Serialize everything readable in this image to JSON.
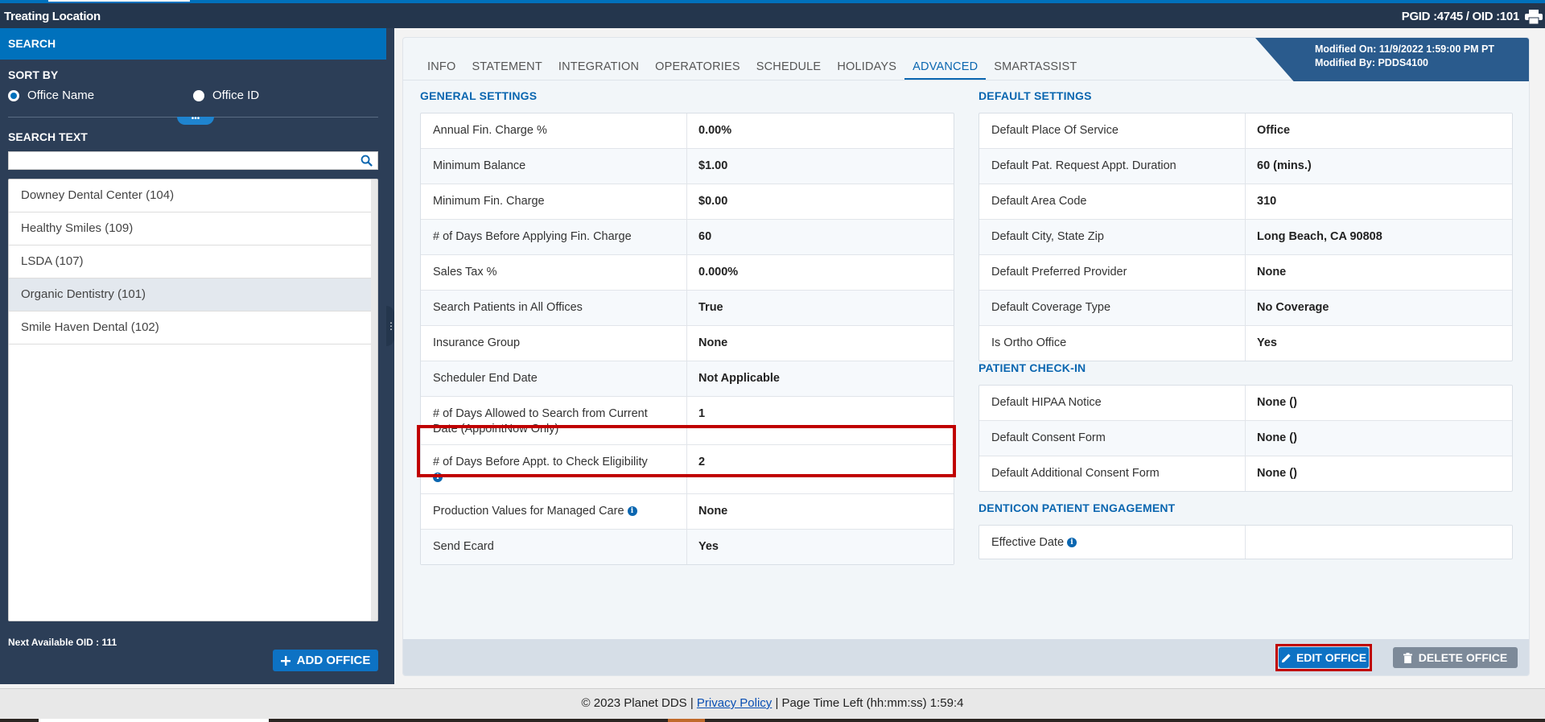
{
  "titlebar": {
    "title": "Treating Location",
    "ids": "PGID :4745  /  OID :101"
  },
  "sidebar": {
    "header": "SEARCH",
    "sort_label": "SORT BY",
    "sort_options": [
      "Office Name",
      "Office ID"
    ],
    "sort_selected": "Office Name",
    "search_label": "SEARCH TEXT",
    "search_value": "",
    "offices": [
      "Downey Dental Center (104)",
      "Healthy Smiles (109)",
      "LSDA (107)",
      "Organic Dentistry (101)",
      "Smile Haven Dental (102)"
    ],
    "active_office": "Organic Dentistry (101)",
    "next_oid": "Next Available OID : 111",
    "add_button": "ADD OFFICE",
    "grip_glyph": "•••"
  },
  "main": {
    "tabs": [
      "INFO",
      "STATEMENT",
      "INTEGRATION",
      "OPERATORIES",
      "SCHEDULE",
      "HOLIDAYS",
      "ADVANCED",
      "SMARTASSIST"
    ],
    "active_tab": "ADVANCED",
    "modified_on": "Modified On: 11/9/2022 1:59:00 PM PT",
    "modified_by": "Modified By: PDDS4100",
    "general": {
      "title": "GENERAL SETTINGS",
      "rows": [
        {
          "label": "Annual Fin. Charge %",
          "value": "0.00%"
        },
        {
          "label": "Minimum Balance",
          "value": "$1.00"
        },
        {
          "label": "Minimum Fin. Charge",
          "value": "$0.00"
        },
        {
          "label": "# of Days Before Applying Fin. Charge",
          "value": "60"
        },
        {
          "label": "Sales Tax %",
          "value": "0.000%"
        },
        {
          "label": "Search Patients in All Offices",
          "value": "True"
        },
        {
          "label": "Insurance Group",
          "value": "None"
        },
        {
          "label": "Scheduler End Date",
          "value": "Not Applicable"
        },
        {
          "label": "# of Days Allowed to Search from Current Date (AppointNow Only)",
          "value": "1"
        },
        {
          "label": "# of Days Before Appt. to Check Eligibility",
          "value": "2"
        },
        {
          "label": "Production Values for Managed Care",
          "value": "None"
        },
        {
          "label": "Send Ecard",
          "value": "Yes"
        }
      ]
    },
    "default": {
      "title": "DEFAULT SETTINGS",
      "rows": [
        {
          "label": "Default Place Of Service",
          "value": "Office"
        },
        {
          "label": "Default Pat. Request Appt. Duration",
          "value": "60 (mins.)"
        },
        {
          "label": "Default Area Code",
          "value": "310"
        },
        {
          "label": "Default City, State Zip",
          "value": "Long Beach, CA 90808"
        },
        {
          "label": "Default Preferred Provider",
          "value": "None"
        },
        {
          "label": "Default Coverage Type",
          "value": "No Coverage"
        },
        {
          "label": "Is Ortho Office",
          "value": "Yes"
        }
      ]
    },
    "checkin": {
      "title": "PATIENT CHECK-IN",
      "rows": [
        {
          "label": "Default HIPAA Notice",
          "value": "None ()"
        },
        {
          "label": "Default Consent Form",
          "value": "None ()"
        },
        {
          "label": "Default Additional Consent Form",
          "value": "None ()"
        }
      ]
    },
    "engagement": {
      "title": "DENTICON PATIENT ENGAGEMENT",
      "rows": [
        {
          "label": "Effective Date",
          "value": ""
        }
      ]
    },
    "info_glyph": "i",
    "edit_button": "EDIT OFFICE",
    "delete_button": "DELETE OFFICE"
  },
  "footer": {
    "copyright": "© 2023 Planet DDS |",
    "privacy": "Privacy Policy",
    "timer": "|  Page Time Left (hh:mm:ss) 1:59:4"
  },
  "colors": {
    "primary": "#0071bc",
    "sidebar": "#2c3e57",
    "highlight": "#c00000",
    "accent_text": "#0a66b0"
  }
}
